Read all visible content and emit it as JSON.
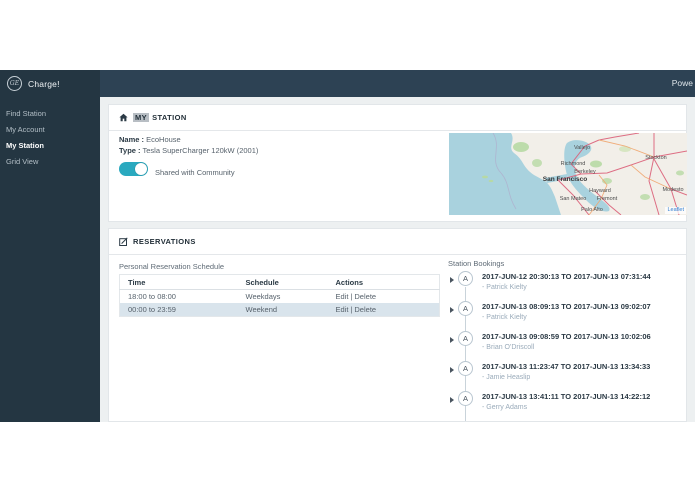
{
  "brand": {
    "logo": "ge-monogram",
    "logo_text": "GE",
    "app_name": "Charge!"
  },
  "topbar": {
    "right_text": "Powe"
  },
  "sidebar": {
    "items": [
      {
        "label": "Find Station",
        "active": false
      },
      {
        "label": "My Account",
        "active": false
      },
      {
        "label": "My Station",
        "active": true
      },
      {
        "label": "Grid View",
        "active": false
      }
    ]
  },
  "my_station": {
    "title_highlight": "MY",
    "title_rest": "STATION",
    "name_label": "Name :",
    "name_value": "EcoHouse",
    "type_label": "Type :",
    "type_value": "Tesla SuperCharger 120kW (2001)",
    "shared_label": "Shared with Community",
    "shared_state": "on"
  },
  "map": {
    "cities": [
      "Vallejo",
      "Richmond",
      "Berkeley",
      "San Francisco",
      "Hayward",
      "San Mateo",
      "Fremont",
      "Palo Alto",
      "Stockton",
      "Modesto"
    ],
    "attribution": "Leaflet"
  },
  "reservations": {
    "title": "RESERVATIONS",
    "schedule": {
      "title": "Personal Reservation Schedule",
      "columns": [
        "Time",
        "Schedule",
        "Actions"
      ],
      "rows": [
        {
          "time": "18:00 to 08:00",
          "schedule": "Weekdays",
          "edit": "Edit",
          "sep": "|",
          "delete": "Delete"
        },
        {
          "time": "00:00 to 23:59",
          "schedule": "Weekend",
          "edit": "Edit",
          "sep": "|",
          "delete": "Delete"
        }
      ]
    },
    "bookings": {
      "title": "Station Bookings",
      "items": [
        {
          "avatar": "A",
          "range": "2017-JUN-12 20:30:13 TO 2017-JUN-13 07:31:44",
          "name": "- Patrick Kielty"
        },
        {
          "avatar": "A",
          "range": "2017-JUN-13 08:09:13 TO 2017-JUN-13 09:02:07",
          "name": "- Patrick Kielty"
        },
        {
          "avatar": "A",
          "range": "2017-JUN-13 09:08:59 TO 2017-JUN-13 10:02:06",
          "name": "- Brian O'Driscoll"
        },
        {
          "avatar": "A",
          "range": "2017-JUN-13 11:23:47 TO 2017-JUN-13 13:34:33",
          "name": "- Jamie Heaslip"
        },
        {
          "avatar": "A",
          "range": "2017-JUN-13 13:41:11 TO 2017-JUN-13 14:22:12",
          "name": "- Gerry Adams"
        }
      ]
    }
  },
  "colors": {
    "topbar": "#2d4254",
    "sidebar": "#243642",
    "accent_teal": "#2aa9bf",
    "content_bg": "#edf0f1",
    "row_alt": "#d9e4ec",
    "link_blue": "#2f7dd1"
  }
}
